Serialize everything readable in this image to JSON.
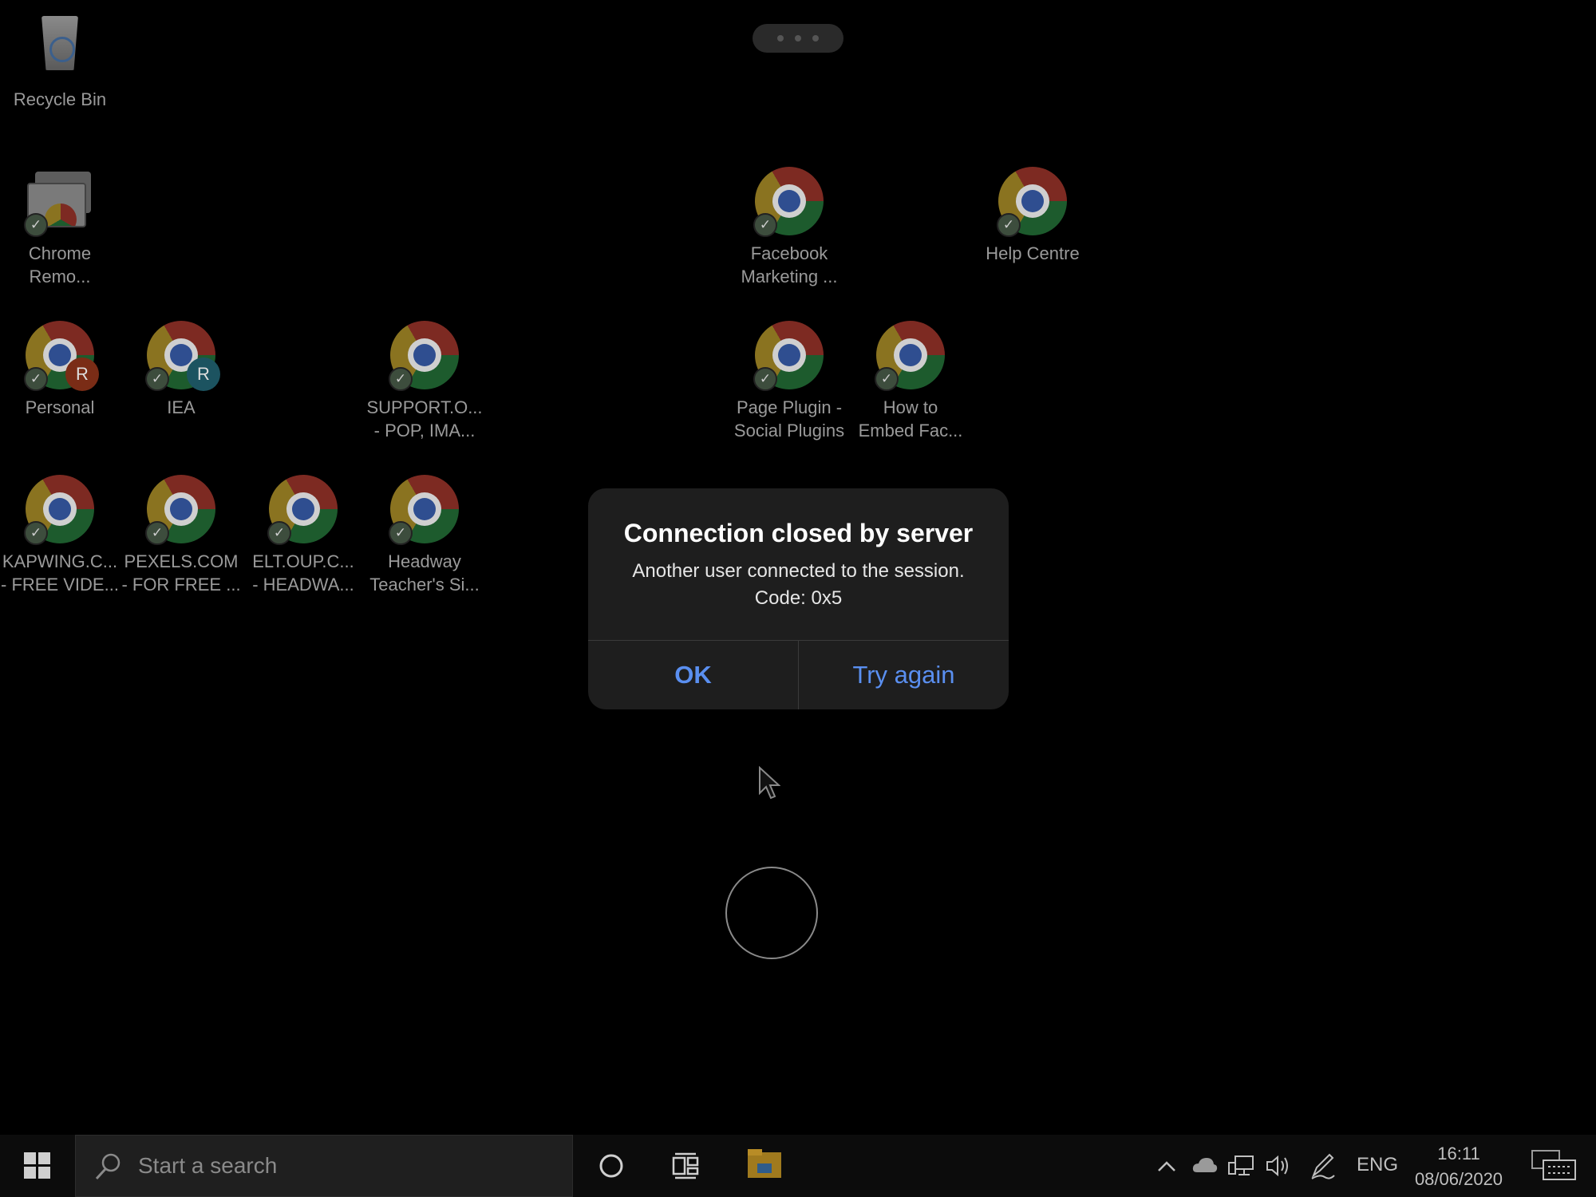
{
  "desktop": {
    "icons": [
      {
        "id": "recycle-bin",
        "label": "Recycle Bin"
      },
      {
        "id": "chrome-remote",
        "label": "Chrome\nRemo..."
      },
      {
        "id": "facebook-marketing",
        "label": "Facebook\nMarketing ..."
      },
      {
        "id": "help-centre",
        "label": "Help Centre"
      },
      {
        "id": "personal",
        "label": "Personal",
        "badge": "R"
      },
      {
        "id": "iea",
        "label": "IEA",
        "badge": "R"
      },
      {
        "id": "support-oup",
        "label": "SUPPORT.O...\n- POP, IMA..."
      },
      {
        "id": "page-plugin",
        "label": "Page Plugin -\nSocial Plugins"
      },
      {
        "id": "how-to-embed",
        "label": "How to\nEmbed Fac..."
      },
      {
        "id": "kapwing",
        "label": "KAPWING.C...\n- FREE VIDE..."
      },
      {
        "id": "pexels",
        "label": "PEXELS.COM\n- FOR FREE ..."
      },
      {
        "id": "elt-oup",
        "label": "ELT.OUP.C...\n- HEADWA..."
      },
      {
        "id": "headway",
        "label": "Headway\nTeacher's Si..."
      }
    ]
  },
  "dialog": {
    "title": "Connection closed by server",
    "message": "Another user connected to the session. Code: 0x5",
    "ok_label": "OK",
    "retry_label": "Try again"
  },
  "taskbar": {
    "search_placeholder": "Start a search",
    "language": "ENG",
    "time": "16:11",
    "date": "08/06/2020"
  },
  "colors": {
    "dialog_bg": "#1e1e1e",
    "accent": "#5a8ff0"
  }
}
